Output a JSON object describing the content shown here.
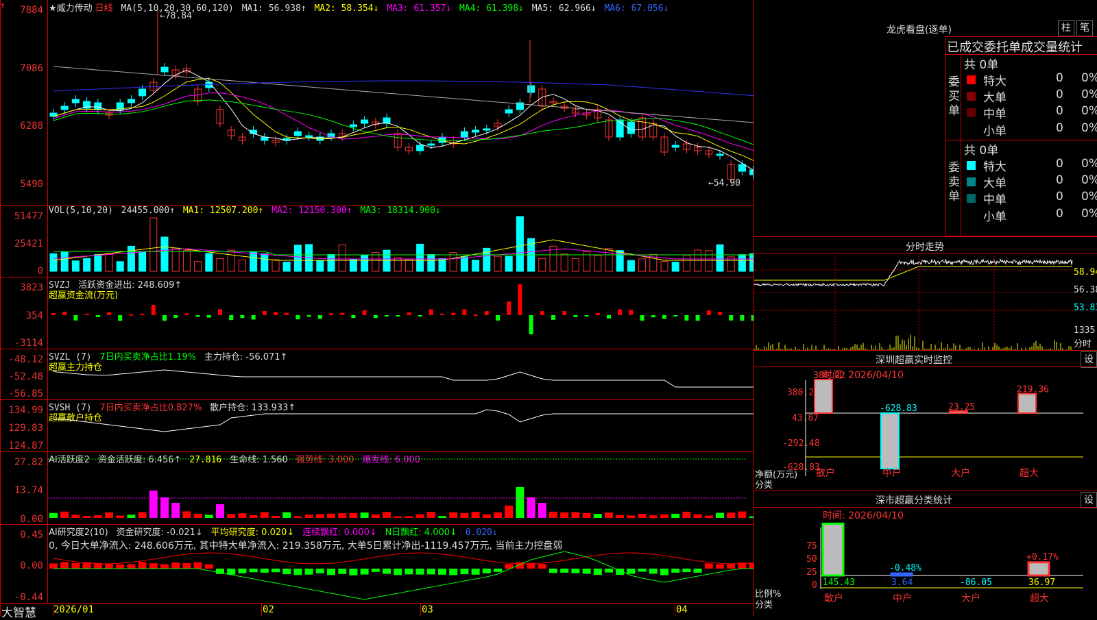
{
  "main": {
    "logo": "大智慧",
    "stock_title": "★威力传动",
    "period": "日线",
    "ma_header": {
      "label": "MA(5,10,20,30,60,120)",
      "ma1": "MA1: 56.938↑",
      "ma2": "MA2: 58.354↓",
      "ma3": "MA3: 61.357↓",
      "ma4": "MA4: 61.398↓",
      "ma5": "MA5: 62.966↓",
      "ma6": "MA6: 67.056↓"
    },
    "price_high_label": "←78.84",
    "price_low_label": "←54.90",
    "price_ticks": [
      "7884",
      "7086",
      "6288",
      "5490"
    ],
    "vol_header": {
      "label": "VOL(5,10,20)",
      "value": "24455.000↑",
      "ma1": "MA1: 12507.200↑",
      "ma2": "MA2: 12150.300↑",
      "ma3": "MA3: 18314.900↓"
    },
    "vol_ticks": [
      "51477",
      "25421",
      "0"
    ],
    "svzj_header": {
      "label": "SVZJ",
      "text": "活跃资金进出: 248.609↑",
      "sub": "超赢资金流(万元)"
    },
    "svzj_ticks": [
      "3823",
      "354",
      "-3114"
    ],
    "svzl_header": {
      "label": "SVZL (7)",
      "ratio": "7日内买卖净占比1.19%",
      "hold": "主力持仓: -56.071↑",
      "sub": "超赢主力持仓"
    },
    "svzl_ticks": [
      "-48.12",
      "-52.48",
      "-56.85"
    ],
    "svsh_header": {
      "label": "SVSH (7)",
      "ratio": "7日内买卖净占比0.827%",
      "hold": "散户持仓: 133.933↑",
      "sub": "超赢散户持仓"
    },
    "svsh_ticks": [
      "134.99",
      "129.83",
      "124.87"
    ],
    "ai_header": {
      "label": "AI活跃度2",
      "a": "资金活跃度: 6.456↑",
      "b": "27.816",
      "c": "生命线: 1.560",
      "d": "强势线: 3.000",
      "e": "爆发线: 6.000"
    },
    "ai_ticks": [
      "27.82",
      "13.74",
      "0.00"
    ],
    "air_header": {
      "label": "AI研究度2(10)",
      "a": "资金研究度: -0.021↓",
      "b": "平均研究度: 0.020↓",
      "c": "连续飘红: 0.000↓",
      "d": "N日飘红: 4.000↓",
      "e": "0.020↓",
      "note": "0, 今日大单净流入: 248.606万元, 其中特大单净流入: 219.358万元, 大单5日累计净出-1119.457万元, 当前主力控盘弱"
    },
    "air_ticks": [
      "0.45",
      "0.00",
      "-0.44"
    ],
    "dates": [
      "2026/01",
      "02",
      "03",
      "04"
    ]
  },
  "right": {
    "title": "龙虎看盘(逐单)",
    "btn1": "柱",
    "btn2": "笔",
    "header": "已成交委托单成交量统计",
    "buy_label": "委买单",
    "sell_label": "委卖单",
    "buy_total": "共 0单",
    "sell_total": "共 0单",
    "rows": [
      {
        "name": "特大",
        "vol": "0",
        "pct": "0%"
      },
      {
        "name": "大单",
        "vol": "0",
        "pct": "0%"
      },
      {
        "name": "中单",
        "vol": "0",
        "pct": "0%"
      },
      {
        "name": "小单",
        "vol": "0",
        "pct": "0%"
      }
    ],
    "intraday_title": "分时走势",
    "intraday_ticks": [
      "58.94",
      "56.38",
      "53.83",
      "1335"
    ],
    "intraday_unit": "分时",
    "sz_title": "深圳超赢实时监控",
    "sz_btn": "设",
    "sz_time": "时间: 2026/04/10",
    "sz_ticks": [
      "380.22",
      "43.87",
      "-292.48",
      "-628.83"
    ],
    "sz_unit": "净额(万元)",
    "sz_axis": "分类",
    "sz_cats": [
      "散户",
      "中户",
      "大户",
      "超大"
    ],
    "sz_values": [
      380.22,
      -628.83,
      23.25,
      219.36
    ],
    "sz_value_labels": [
      "380.22",
      "-628.83",
      "23.25",
      "219.36"
    ],
    "cl_title": "深市超赢分类统计",
    "cl_btn": "设",
    "cl_time": "时间: 2026/04/10",
    "cl_ticks": [
      "75",
      "50",
      "25",
      "0"
    ],
    "cl_unit": "比例%",
    "cl_axis": "分类",
    "cl_cats": [
      "散户",
      "中户",
      "大户",
      "超大"
    ],
    "cl_values": [
      145.43,
      3.64,
      -86.05,
      36.97
    ],
    "cl_pcts": [
      "",
      "-0.48%",
      "",
      "+0.17%"
    ]
  },
  "chart_data": {
    "type": "candlestick",
    "title": "威力传动 日线",
    "high_marker": 78.84,
    "low_marker": 54.9,
    "ylim": [
      54.9,
      78.84
    ]
  }
}
